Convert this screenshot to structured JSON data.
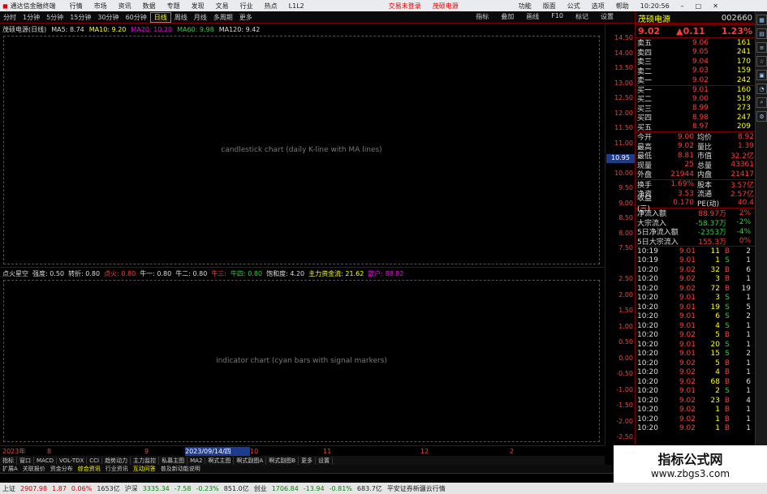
{
  "titlebar": {
    "app": "通达信金融终端",
    "menu": [
      "行情",
      "市场",
      "资讯",
      "数据",
      "专题",
      "发现",
      "文易",
      "行业",
      "热点",
      "L1L2"
    ],
    "center_links": [
      "交易未登录",
      "茂硕电源"
    ],
    "right_items": [
      "功能",
      "版面",
      "公式",
      "选项",
      "帮助"
    ],
    "clock": "10:20:56"
  },
  "timeframes": [
    "分时",
    "1分钟",
    "5分钟",
    "15分钟",
    "30分钟",
    "60分钟",
    "日线",
    "周线",
    "月线",
    "多周期",
    "更多"
  ],
  "timeframe_active": "日线",
  "chart_tools": [
    "指标",
    "叠加",
    "画线",
    "F10",
    "标记",
    "设置"
  ],
  "stock": {
    "name": "茂硕电源",
    "code": "002660",
    "last": "9.02",
    "change": "0.11",
    "pct": "1.23%"
  },
  "ma_line": [
    {
      "text": "茂硕电源(日线)",
      "color": "#ddd"
    },
    {
      "text": "MA5: 8.74",
      "color": "#ddd"
    },
    {
      "text": "MA10: 9.20",
      "color": "#ff0"
    },
    {
      "text": "MA20: 10.20",
      "color": "#e0e"
    },
    {
      "text": "MA60: 9.98",
      "color": "#2ecc40"
    },
    {
      "text": "MA120: 9.42",
      "color": "#ddd"
    }
  ],
  "price_axis": [
    "14.50",
    "14.00",
    "13.50",
    "13.00",
    "12.50",
    "12.00",
    "11.50",
    "11.00",
    "10.50",
    "10.00",
    "9.50",
    "9.00",
    "8.50",
    "8.00",
    "7.50"
  ],
  "current_price_marker": "10.95",
  "indicator": {
    "name": "点火星空",
    "params": [
      {
        "text": "强度: 0.50",
        "color": "#ddd"
      },
      {
        "text": "转折: 0.80",
        "color": "#ddd"
      },
      {
        "text": "点火: 0.80",
        "color": "#ff3b3b"
      },
      {
        "text": "牛一: 0.80",
        "color": "#ddd"
      },
      {
        "text": "牛二: 0.80",
        "color": "#ddd"
      },
      {
        "text": "牛三:",
        "color": "#ff3b3b"
      },
      {
        "text": "牛四: 0.80",
        "color": "#2ecc40"
      },
      {
        "text": "饱和度: 4.20",
        "color": "#ddd"
      },
      {
        "text": "主力资金流: 21.62",
        "color": "#ff0"
      },
      {
        "text": "散户: 88.82",
        "color": "#e0e"
      }
    ],
    "axis": [
      "2.50",
      "2.00",
      "1.50",
      "1.00",
      "0.50",
      "0.00",
      "-0.50",
      "-1.00",
      "-1.50",
      "-2.00",
      "-2.50"
    ]
  },
  "x_axis": {
    "labels": [
      "2023年",
      "8",
      "9",
      "2023/09/14/四",
      "10",
      "11",
      "12",
      "2"
    ]
  },
  "tabs_row1": [
    "指标",
    "窗口",
    "MACD",
    "VOL-TDX",
    "CCI",
    "趋势动力",
    "主力监控",
    "私募主图",
    "MA2",
    "啊式主图",
    "啊式副图A",
    "啊式副图B",
    "更多",
    "设置"
  ],
  "tabs_row2": [
    "扩展A",
    "关联报价",
    "资金分布",
    "综合资讯",
    "行业资讯",
    "互动问答",
    "普及新动能说明"
  ],
  "quote": {
    "orderbook": [
      {
        "label": "卖五",
        "price": "9.06",
        "vol": "161"
      },
      {
        "label": "卖四",
        "price": "9.05",
        "vol": "241"
      },
      {
        "label": "卖三",
        "price": "9.04",
        "vol": "170"
      },
      {
        "label": "卖二",
        "price": "9.03",
        "vol": "159"
      },
      {
        "label": "卖一",
        "price": "9.02",
        "vol": "242"
      },
      {
        "label": "买一",
        "price": "9.01",
        "vol": "160"
      },
      {
        "label": "买二",
        "price": "9.00",
        "vol": "519"
      },
      {
        "label": "买三",
        "price": "8.99",
        "vol": "273"
      },
      {
        "label": "买四",
        "price": "8.98",
        "vol": "247"
      },
      {
        "label": "买五",
        "price": "8.97",
        "vol": "209"
      }
    ],
    "stats": [
      {
        "l1": "今开",
        "v1": "9.00",
        "l2": "均价",
        "v2": "8.92"
      },
      {
        "l1": "最高",
        "v1": "9.02",
        "l2": "量比",
        "v2": "1.39"
      },
      {
        "l1": "最低",
        "v1": "8.81",
        "l2": "市值",
        "v2": "32.2亿"
      },
      {
        "l1": "现量",
        "v1": "25",
        "l2": "总量",
        "v2": "43361"
      },
      {
        "l1": "外盘",
        "v1": "21944",
        "l2": "内盘",
        "v2": "21417"
      }
    ],
    "stats2": [
      {
        "l1": "换手",
        "v1": "1.69%",
        "l2": "股本",
        "v2": "3.57亿"
      },
      {
        "l1": "净资",
        "v1": "3.53",
        "l2": "流通",
        "v2": "2.57亿"
      },
      {
        "l1": "收益(三)",
        "v1": "0.170",
        "l2": "PE(动)",
        "v2": "40.4"
      }
    ],
    "flow": [
      {
        "label": "净流入额",
        "value": "88.97万",
        "pct": "2%"
      },
      {
        "label": "大宗流入",
        "value": "-58.37万",
        "pct": "-2%"
      },
      {
        "label": "5日净流入额",
        "value": "-2353万",
        "pct": "-4%"
      },
      {
        "label": "5日大宗流入",
        "value": "155.3万",
        "pct": "0%"
      }
    ],
    "ticks": [
      {
        "t": "10:19",
        "p": "9.01",
        "v": "11",
        "s": "B",
        "n": "2"
      },
      {
        "t": "10:19",
        "p": "9.01",
        "v": "1",
        "s": "S",
        "n": "1"
      },
      {
        "t": "10:20",
        "p": "9.02",
        "v": "32",
        "s": "B",
        "n": "6"
      },
      {
        "t": "10:20",
        "p": "9.02",
        "v": "3",
        "s": "B",
        "n": "1"
      },
      {
        "t": "10:20",
        "p": "9.02",
        "v": "72",
        "s": "B",
        "n": "19"
      },
      {
        "t": "10:20",
        "p": "9.01",
        "v": "3",
        "s": "S",
        "n": "1"
      },
      {
        "t": "10:20",
        "p": "9.01",
        "v": "19",
        "s": "S",
        "n": "5"
      },
      {
        "t": "10:20",
        "p": "9.01",
        "v": "6",
        "s": "S",
        "n": "2"
      },
      {
        "t": "10:20",
        "p": "9.01",
        "v": "4",
        "s": "S",
        "n": "1"
      },
      {
        "t": "10:20",
        "p": "9.02",
        "v": "5",
        "s": "B",
        "n": "1"
      },
      {
        "t": "10:20",
        "p": "9.01",
        "v": "20",
        "s": "S",
        "n": "1"
      },
      {
        "t": "10:20",
        "p": "9.01",
        "v": "15",
        "s": "S",
        "n": "2"
      },
      {
        "t": "10:20",
        "p": "9.02",
        "v": "5",
        "s": "B",
        "n": "1"
      },
      {
        "t": "10:20",
        "p": "9.02",
        "v": "4",
        "s": "B",
        "n": "1"
      },
      {
        "t": "10:20",
        "p": "9.02",
        "v": "68",
        "s": "B",
        "n": "6"
      },
      {
        "t": "10:20",
        "p": "9.01",
        "v": "2",
        "s": "S",
        "n": "1"
      },
      {
        "t": "10:20",
        "p": "9.02",
        "v": "23",
        "s": "B",
        "n": "4"
      },
      {
        "t": "10:20",
        "p": "9.02",
        "v": "1",
        "s": "B",
        "n": "1"
      },
      {
        "t": "10:20",
        "p": "9.02",
        "v": "1",
        "s": "B",
        "n": "1"
      },
      {
        "t": "10:20",
        "p": "9.02",
        "v": "1",
        "s": "B",
        "n": "1"
      }
    ]
  },
  "statusbar": {
    "items": [
      {
        "text": "上证",
        "color": "#222"
      },
      {
        "text": "2907.98",
        "color": "#c00"
      },
      {
        "text": "1.87",
        "color": "#c00"
      },
      {
        "text": "0.06%",
        "color": "#c00"
      },
      {
        "text": "1653亿",
        "color": "#222"
      },
      {
        "text": "沪深",
        "color": "#222"
      },
      {
        "text": "3335.34",
        "color": "#080"
      },
      {
        "text": "-7.58",
        "color": "#080"
      },
      {
        "text": "-0.23%",
        "color": "#080"
      },
      {
        "text": "851.0亿",
        "color": "#222"
      },
      {
        "text": "创业",
        "color": "#222"
      },
      {
        "text": "1706.84",
        "color": "#080"
      },
      {
        "text": "-13.94",
        "color": "#080"
      },
      {
        "text": "-0.81%",
        "color": "#080"
      },
      {
        "text": "683.7亿",
        "color": "#222"
      },
      {
        "text": "平安证券新疆云行情",
        "color": "#222"
      }
    ]
  },
  "logo": {
    "title": "指标公式网",
    "url": "www.zbgs3.com"
  }
}
